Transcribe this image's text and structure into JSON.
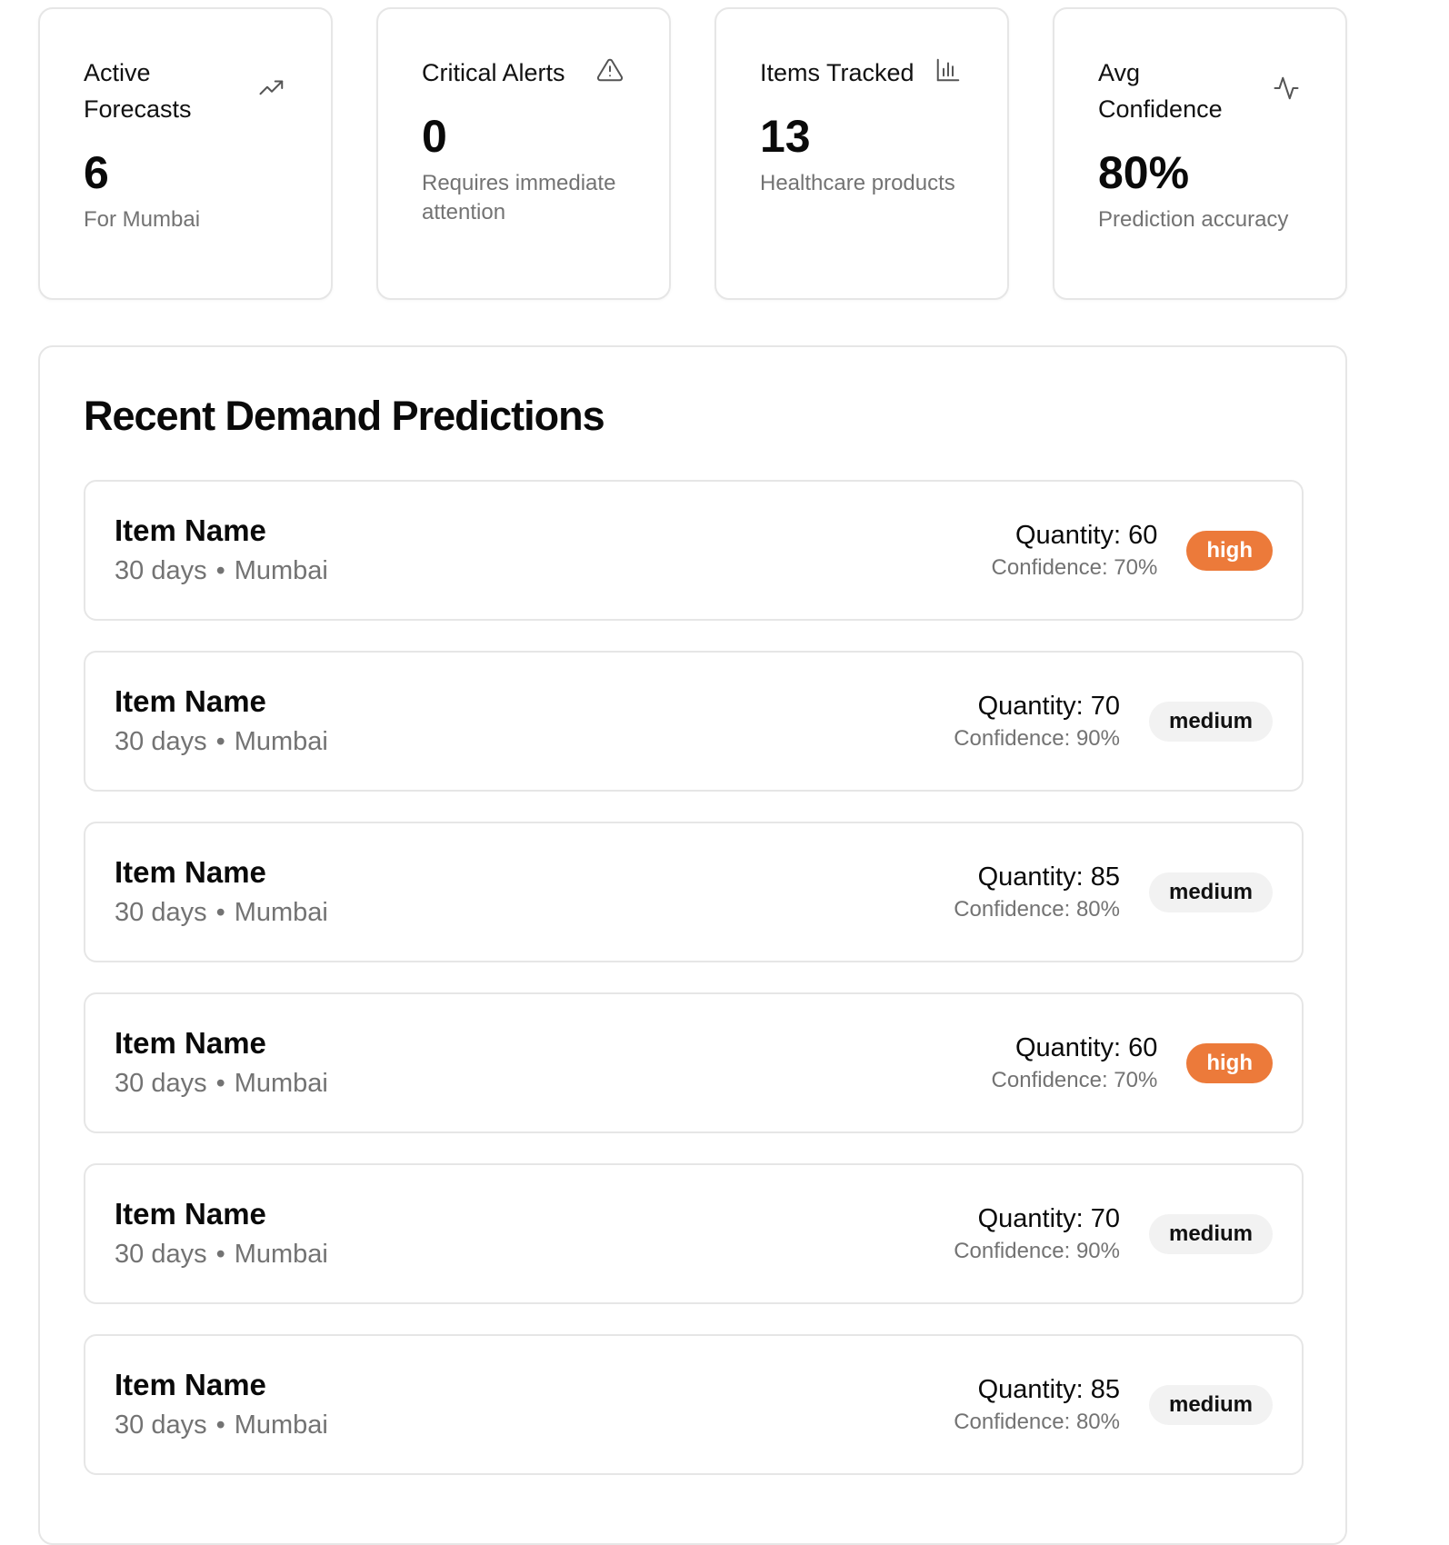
{
  "stats": [
    {
      "title": "Active Forecasts",
      "value": "6",
      "sub": "For Mumbai",
      "icon": "trending-up-icon"
    },
    {
      "title": "Critical Alerts",
      "value": "0",
      "sub": "Requires immediate attention",
      "icon": "alert-triangle-icon"
    },
    {
      "title": "Items Tracked",
      "value": "13",
      "sub": "Healthcare products",
      "icon": "bar-chart-icon"
    },
    {
      "title": "Avg Confidence",
      "value": "80%",
      "sub": "Prediction accuracy",
      "icon": "activity-icon"
    }
  ],
  "panel": {
    "title": "Recent Demand Predictions"
  },
  "predictions": [
    {
      "name": "Item Name",
      "period": "30 days",
      "separator": "•",
      "location": "Mumbai",
      "quantity": "Quantity: 60",
      "confidence": "Confidence: 70%",
      "badge": "high"
    },
    {
      "name": "Item Name",
      "period": "30 days",
      "separator": "•",
      "location": "Mumbai",
      "quantity": "Quantity: 70",
      "confidence": "Confidence: 90%",
      "badge": "medium"
    },
    {
      "name": "Item Name",
      "period": "30 days",
      "separator": "•",
      "location": "Mumbai",
      "quantity": "Quantity: 85",
      "confidence": "Confidence: 80%",
      "badge": "medium"
    },
    {
      "name": "Item Name",
      "period": "30 days",
      "separator": "•",
      "location": "Mumbai",
      "quantity": "Quantity: 60",
      "confidence": "Confidence: 70%",
      "badge": "high"
    },
    {
      "name": "Item Name",
      "period": "30 days",
      "separator": "•",
      "location": "Mumbai",
      "quantity": "Quantity: 70",
      "confidence": "Confidence: 90%",
      "badge": "medium"
    },
    {
      "name": "Item Name",
      "period": "30 days",
      "separator": "•",
      "location": "Mumbai",
      "quantity": "Quantity: 85",
      "confidence": "Confidence: 80%",
      "badge": "medium"
    }
  ],
  "colors": {
    "high_badge": "#ec7a3a",
    "medium_badge": "#f2f2f2",
    "muted_text": "#737373",
    "border": "#e6e6e6"
  }
}
